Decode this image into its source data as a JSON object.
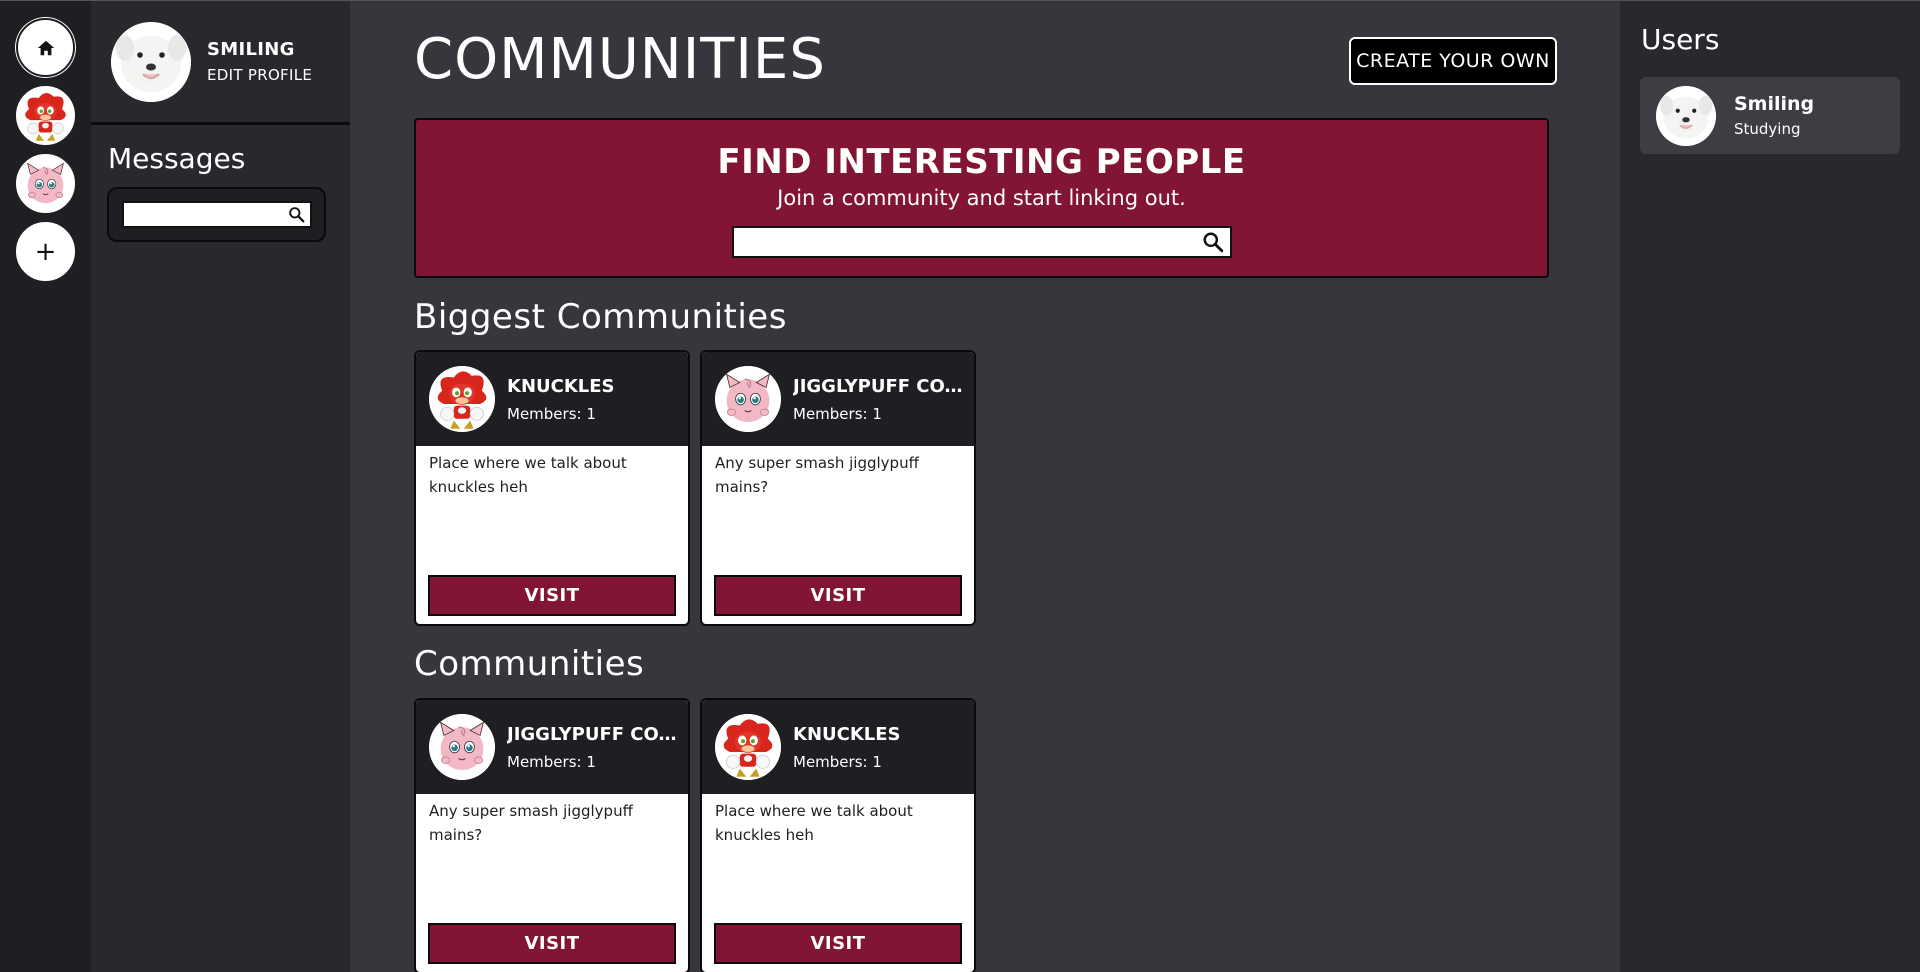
{
  "rail": {
    "home_icon": "home-icon",
    "servers": [
      {
        "name": "Knuckles",
        "avatar": "knuckles-icon"
      },
      {
        "name": "Jigglypuff",
        "avatar": "jigglypuff-icon"
      }
    ],
    "add_label": "+"
  },
  "profile": {
    "name": "SMILING",
    "edit_label": "EDIT PROFILE"
  },
  "messages": {
    "title": "Messages",
    "search_placeholder": ""
  },
  "main": {
    "title": "COMMUNITIES",
    "create_label": "CREATE YOUR OWN",
    "hero": {
      "heading": "FIND INTERESTING PEOPLE",
      "subheading": "Join a community and start linking out.",
      "search_placeholder": ""
    },
    "biggest_title": "Biggest Communities",
    "communities_title": "Communities",
    "biggest": [
      {
        "name": "KNUCKLES",
        "members": "Members: 1",
        "description": "Place where we talk about knuckles heh",
        "visit_label": "VISIT"
      },
      {
        "name": "JIGGLYPUFF CO...",
        "members": "Members: 1",
        "description": "Any super smash jigglypuff mains?",
        "visit_label": "VISIT"
      }
    ],
    "all": [
      {
        "name": "JIGGLYPUFF CO...",
        "members": "Members: 1",
        "description": "Any super smash jigglypuff mains?",
        "visit_label": "VISIT"
      },
      {
        "name": "KNUCKLES",
        "members": "Members: 1",
        "description": "Place where we talk about knuckles heh",
        "visit_label": "VISIT"
      }
    ]
  },
  "users": {
    "title": "Users",
    "list": [
      {
        "name": "Smiling",
        "status": "Studying"
      }
    ]
  },
  "colors": {
    "accent": "#821533",
    "dark": "#1e1f22",
    "panel": "#27292d",
    "main_bg": "#35373c"
  }
}
